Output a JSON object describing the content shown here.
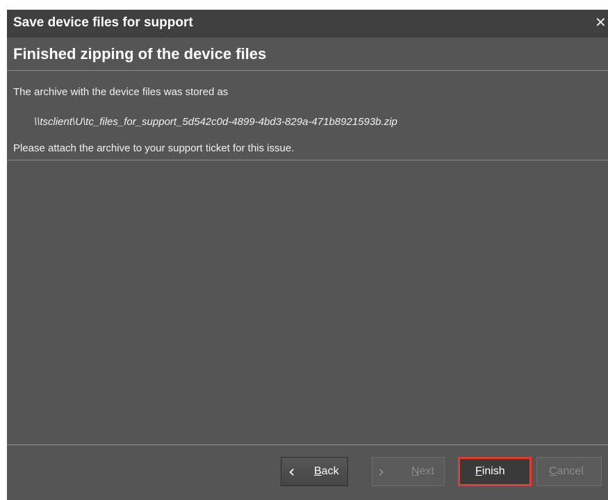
{
  "dialog": {
    "title": "Save device files for support",
    "close_glyph": "✕"
  },
  "content": {
    "heading": "Finished zipping of the device files",
    "line1": "The archive with the device files was stored as",
    "archive_path": "\\\\tsclient\\U\\tc_files_for_support_5d542c0d-4899-4bd3-829a-471b8921593b.zip",
    "line2": "Please attach the archive to your support ticket for this issue."
  },
  "buttons": {
    "back": {
      "accel": "B",
      "rest": "ack",
      "icon": "chevron-left-icon",
      "enabled": true
    },
    "next": {
      "accel": "N",
      "rest": "ext",
      "icon": "chevron-right-icon",
      "enabled": false
    },
    "finish": {
      "accel": "F",
      "rest": "inish",
      "enabled": true,
      "highlighted": true
    },
    "cancel": {
      "accel": "C",
      "rest": "ancel",
      "enabled": false
    }
  },
  "colors": {
    "dialog_bg": "#555555",
    "titlebar_bg": "#3f3f3f",
    "highlight": "#e53b2c"
  }
}
